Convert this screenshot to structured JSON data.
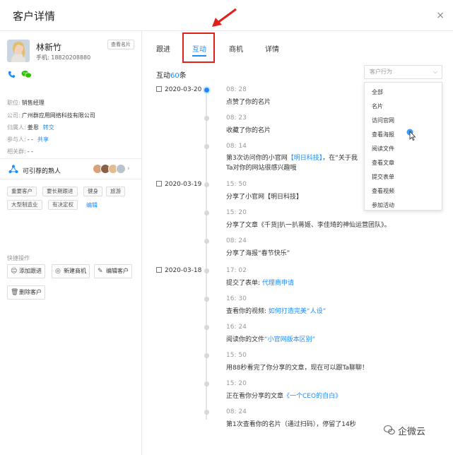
{
  "header": {
    "title": "客户详情",
    "close": "×"
  },
  "customer": {
    "name": "林新竹",
    "phone": "手机: 18820208880",
    "view_card": "查看名片"
  },
  "info": [
    {
      "label": "职位:",
      "value": "销售经理",
      "link": ""
    },
    {
      "label": "公司:",
      "value": "广州群应用网络科技有限公司",
      "link": ""
    },
    {
      "label": "归属人:",
      "value": "姜恩",
      "link": "转交"
    },
    {
      "label": "参与人:",
      "value": "- -",
      "link": "共享"
    },
    {
      "label": "相关群:",
      "value": "- -",
      "link": ""
    }
  ],
  "recommend": {
    "label": "可引荐的熟人"
  },
  "tags": [
    "重要客户",
    "要长期跟进",
    "健身",
    "旅游",
    "大型制造业",
    "有决定权"
  ],
  "tags_edit": "编辑",
  "quick": {
    "title": "快捷操作",
    "buttons": [
      "添加跟进",
      "新建商机",
      "编辑客户",
      "删除客户"
    ]
  },
  "tabs": [
    "跟进",
    "互动",
    "商机",
    "详情"
  ],
  "interaction": {
    "prefix": "互动",
    "count": "60",
    "suffix": "条"
  },
  "filter": {
    "placeholder": "客户行为",
    "options": [
      "全部",
      "名片",
      "访问官网",
      "查看海报",
      "阅读文件",
      "查看文章",
      "提交表单",
      "查看视频",
      "参加活动"
    ]
  },
  "timeline": [
    {
      "date": "2020-03-20",
      "time": "08: 28",
      "text": "点赞了你的名片",
      "hl": "",
      "tail": ""
    },
    {
      "date": "",
      "time": "08: 23",
      "text": "收藏了你的名片",
      "hl": "",
      "tail": ""
    },
    {
      "date": "",
      "time": "08: 14",
      "text": "第3次访问你的小官网",
      "hl": "【明日科技】",
      "tail": "，在“关于我",
      "line2": "Ta对你的网站很感兴趣哦"
    },
    {
      "date": "2020-03-19",
      "time": "15: 50",
      "text": "分享了小官网【明日科技】",
      "hl": "",
      "tail": ""
    },
    {
      "date": "",
      "time": "15: 20",
      "text": "分享了文章《千货|扒一扒蒋姬、李佳琦的神仙运营团队》。",
      "hl": "",
      "tail": ""
    },
    {
      "date": "",
      "time": "08: 24",
      "text": "分享了海报“春节快乐”",
      "hl": "",
      "tail": ""
    },
    {
      "date": "2020-03-18",
      "time": "17: 02",
      "text": "提交了表单: ",
      "hl": "代理商申请",
      "tail": ""
    },
    {
      "date": "",
      "time": "16: 30",
      "text": "查看你的视频: ",
      "hl": "如何打造完美“人设”",
      "tail": ""
    },
    {
      "date": "",
      "time": "16: 24",
      "text": "阅读你的文件",
      "hl": "“小官网版本区别”",
      "tail": ""
    },
    {
      "date": "",
      "time": "15: 50",
      "text": "用88秒看完了你分享的文章，现在可以跟Ta聊聊！",
      "hl": "",
      "tail": ""
    },
    {
      "date": "",
      "time": "15: 20",
      "text": "正在看你分享的文章",
      "hl": "《一个CEO的自白》",
      "tail": ""
    },
    {
      "date": "",
      "time": "08: 24",
      "text": "第1次查看你的名片（通过扫码），停留了14秒",
      "hl": "",
      "tail": ""
    }
  ],
  "watermark": "企微云",
  "colors": {
    "accent": "#1a8cff",
    "highlight": "#e0201a",
    "wechat": "#2dc100"
  }
}
